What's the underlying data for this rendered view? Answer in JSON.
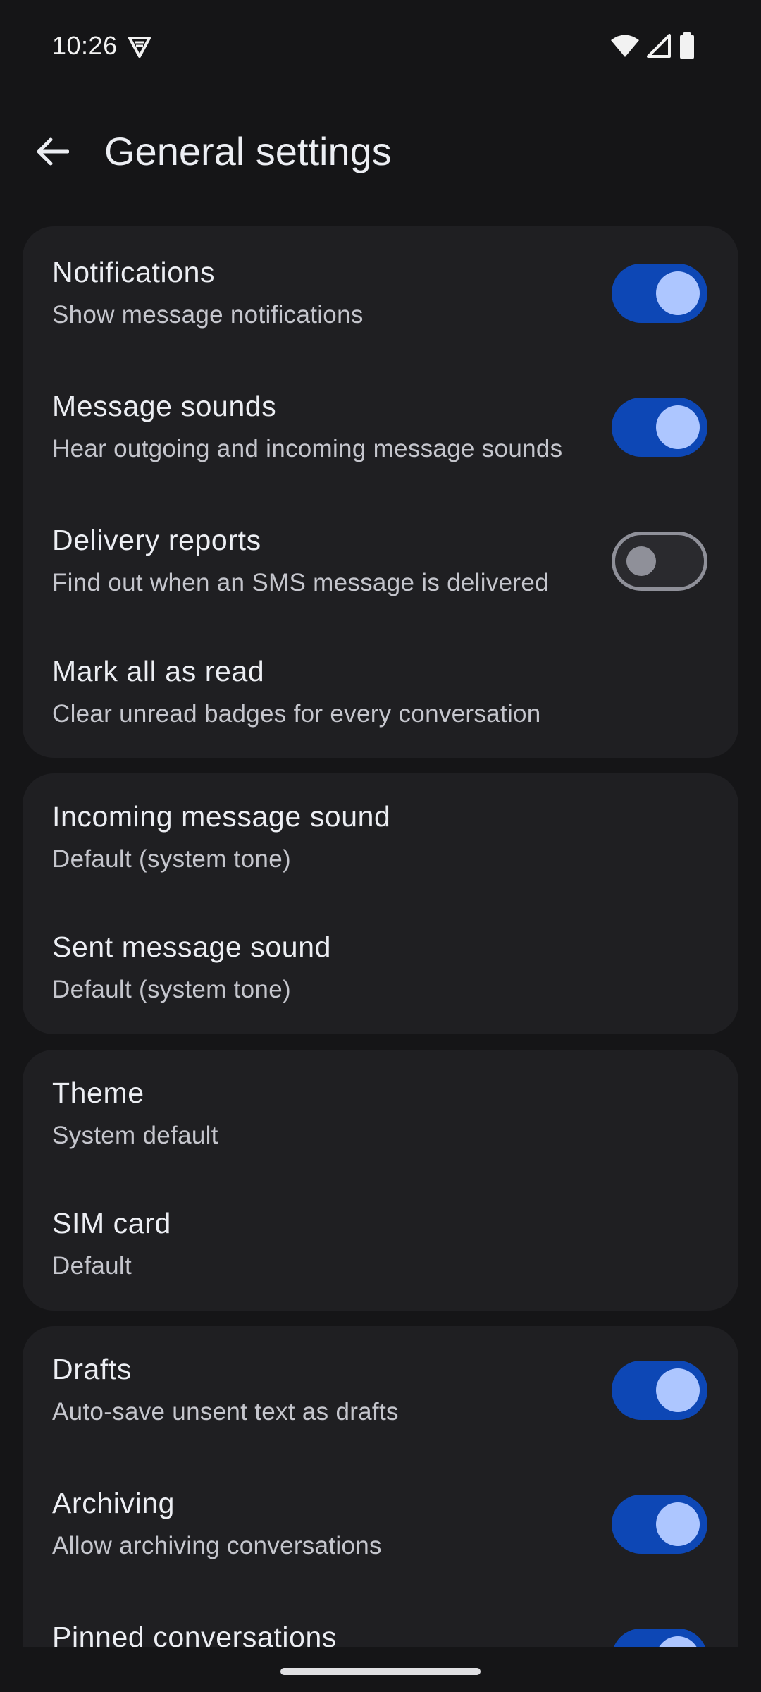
{
  "status_bar": {
    "time": "10:26"
  },
  "app_bar": {
    "title": "General settings"
  },
  "groups": [
    {
      "items": [
        {
          "title": "Notifications",
          "subtitle": "Show message notifications",
          "toggle": "on"
        },
        {
          "title": "Message sounds",
          "subtitle": "Hear outgoing and incoming message sounds",
          "toggle": "on"
        },
        {
          "title": "Delivery reports",
          "subtitle": "Find out when an SMS message is delivered",
          "toggle": "off"
        },
        {
          "title": "Mark all as read",
          "subtitle": "Clear unread badges for every conversation"
        }
      ]
    },
    {
      "items": [
        {
          "title": "Incoming message sound",
          "subtitle": "Default (system tone)"
        },
        {
          "title": "Sent message sound",
          "subtitle": "Default (system tone)"
        }
      ]
    },
    {
      "items": [
        {
          "title": "Theme",
          "subtitle": "System default"
        },
        {
          "title": "SIM card",
          "subtitle": "Default"
        }
      ]
    },
    {
      "items": [
        {
          "title": "Drafts",
          "subtitle": "Auto-save unsent text as drafts",
          "toggle": "on"
        },
        {
          "title": "Archiving",
          "subtitle": "Allow archiving conversations",
          "toggle": "on"
        },
        {
          "title": "Pinned conversations",
          "toggle": "on"
        }
      ]
    }
  ],
  "colors": {
    "background": "#151517",
    "card": "#1f1f22",
    "toggle_on_track": "#0d47b5",
    "toggle_on_knob": "#adc6ff",
    "toggle_off_outline": "#8f9099"
  }
}
